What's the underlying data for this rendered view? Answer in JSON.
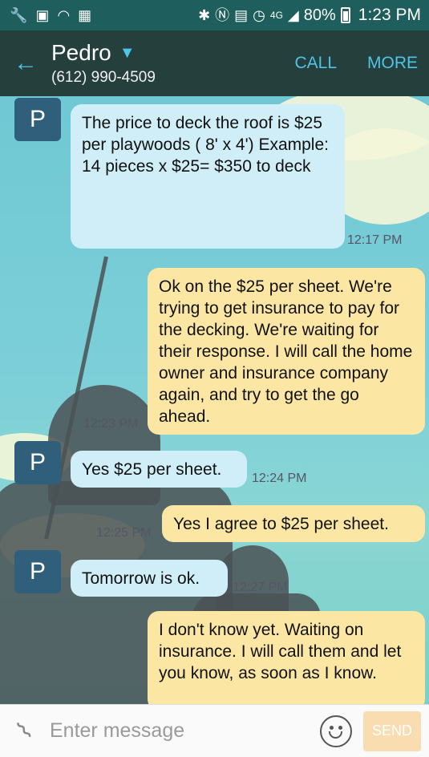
{
  "status_bar": {
    "battery": "80%",
    "time": "1:23 PM",
    "icons": [
      "wrench-icon",
      "image-icon",
      "wifi-icon",
      "calendar-icon",
      "bluetooth-icon",
      "nfc-icon",
      "msg-icon",
      "alarm-icon",
      "lte-icon",
      "signal-icon",
      "battery-icon"
    ]
  },
  "header": {
    "contact_name": "Pedro",
    "phone": "(612) 990-4509",
    "call_label": "CALL",
    "more_label": "MORE"
  },
  "messages": [
    {
      "dir": "in",
      "avatar": "P",
      "text": "The price to deck the roof is $25 per playwoods ( 8' x 4') Example: 14 pieces x $25= $350 to deck",
      "time": "12:17 PM"
    },
    {
      "dir": "out",
      "text": "Ok on the $25 per sheet. We're trying to get insurance to pay for the decking. We're waiting for their response. I will call the home owner and insurance company again, and try to get the go ahead.",
      "time": "12:23 PM"
    },
    {
      "dir": "in",
      "avatar": "P",
      "text": "Yes $25 per sheet.",
      "time": "12:24 PM"
    },
    {
      "dir": "out",
      "text": "Yes I agree to $25 per sheet.",
      "time": "12:25 PM"
    },
    {
      "dir": "in",
      "avatar": "P",
      "text": "Tomorrow is ok.",
      "time": "12:27 PM"
    },
    {
      "dir": "out",
      "text": "I don't know yet. Waiting on insurance.  I will call them and let you know, as soon as I know.",
      "time": ""
    }
  ],
  "composer": {
    "placeholder": "Enter message",
    "send_label": "SEND"
  },
  "colors": {
    "status_bar": "#1e5e5c",
    "app_bar": "#253f3c",
    "accent": "#4fc3e8",
    "incoming_bubble": "#cfeef7",
    "outgoing_bubble": "#fbe7a3",
    "send_disabled": "#f9dcb0"
  }
}
